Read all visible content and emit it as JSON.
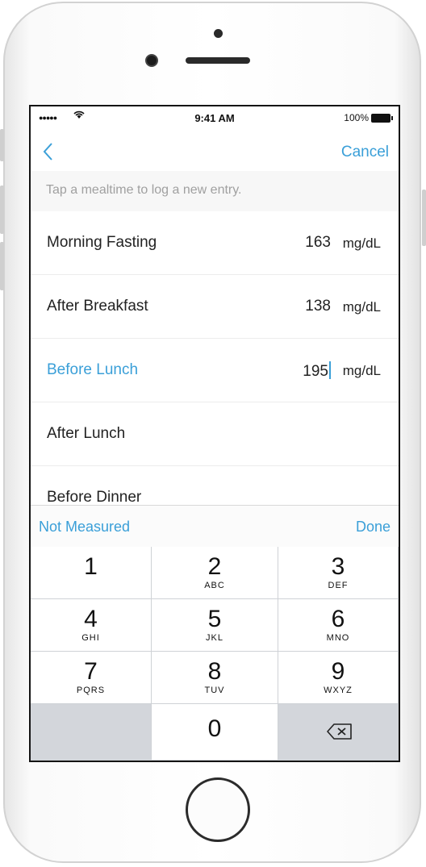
{
  "status_bar": {
    "time": "9:41 AM",
    "battery": "100%",
    "signal": "●●●●●",
    "wifi": "wifi-icon"
  },
  "nav": {
    "back_icon": "chevron-left-icon",
    "cancel_label": "Cancel"
  },
  "hint": "Tap a mealtime to log a new entry.",
  "entries": [
    {
      "label": "Morning Fasting",
      "value": "163",
      "unit": "mg/dL"
    },
    {
      "label": "After Breakfast",
      "value": "138",
      "unit": "mg/dL"
    },
    {
      "label": "Before Lunch",
      "value": "195",
      "unit": "mg/dL"
    },
    {
      "label": "After Lunch",
      "value": "",
      "unit": ""
    },
    {
      "label": "Before Dinner",
      "value": "",
      "unit": ""
    }
  ],
  "toolbar": {
    "not_measured": "Not Measured",
    "done": "Done"
  },
  "keys": [
    {
      "num": "1",
      "letters": ""
    },
    {
      "num": "2",
      "letters": "ABC"
    },
    {
      "num": "3",
      "letters": "DEF"
    },
    {
      "num": "4",
      "letters": "GHI"
    },
    {
      "num": "5",
      "letters": "JKL"
    },
    {
      "num": "6",
      "letters": "MNO"
    },
    {
      "num": "7",
      "letters": "PQRS"
    },
    {
      "num": "8",
      "letters": "TUV"
    },
    {
      "num": "9",
      "letters": "WXYZ"
    },
    {
      "num": "0",
      "letters": ""
    }
  ],
  "colors": {
    "accent": "#3a9fd8",
    "keypad_bg": "#d3d6db"
  }
}
